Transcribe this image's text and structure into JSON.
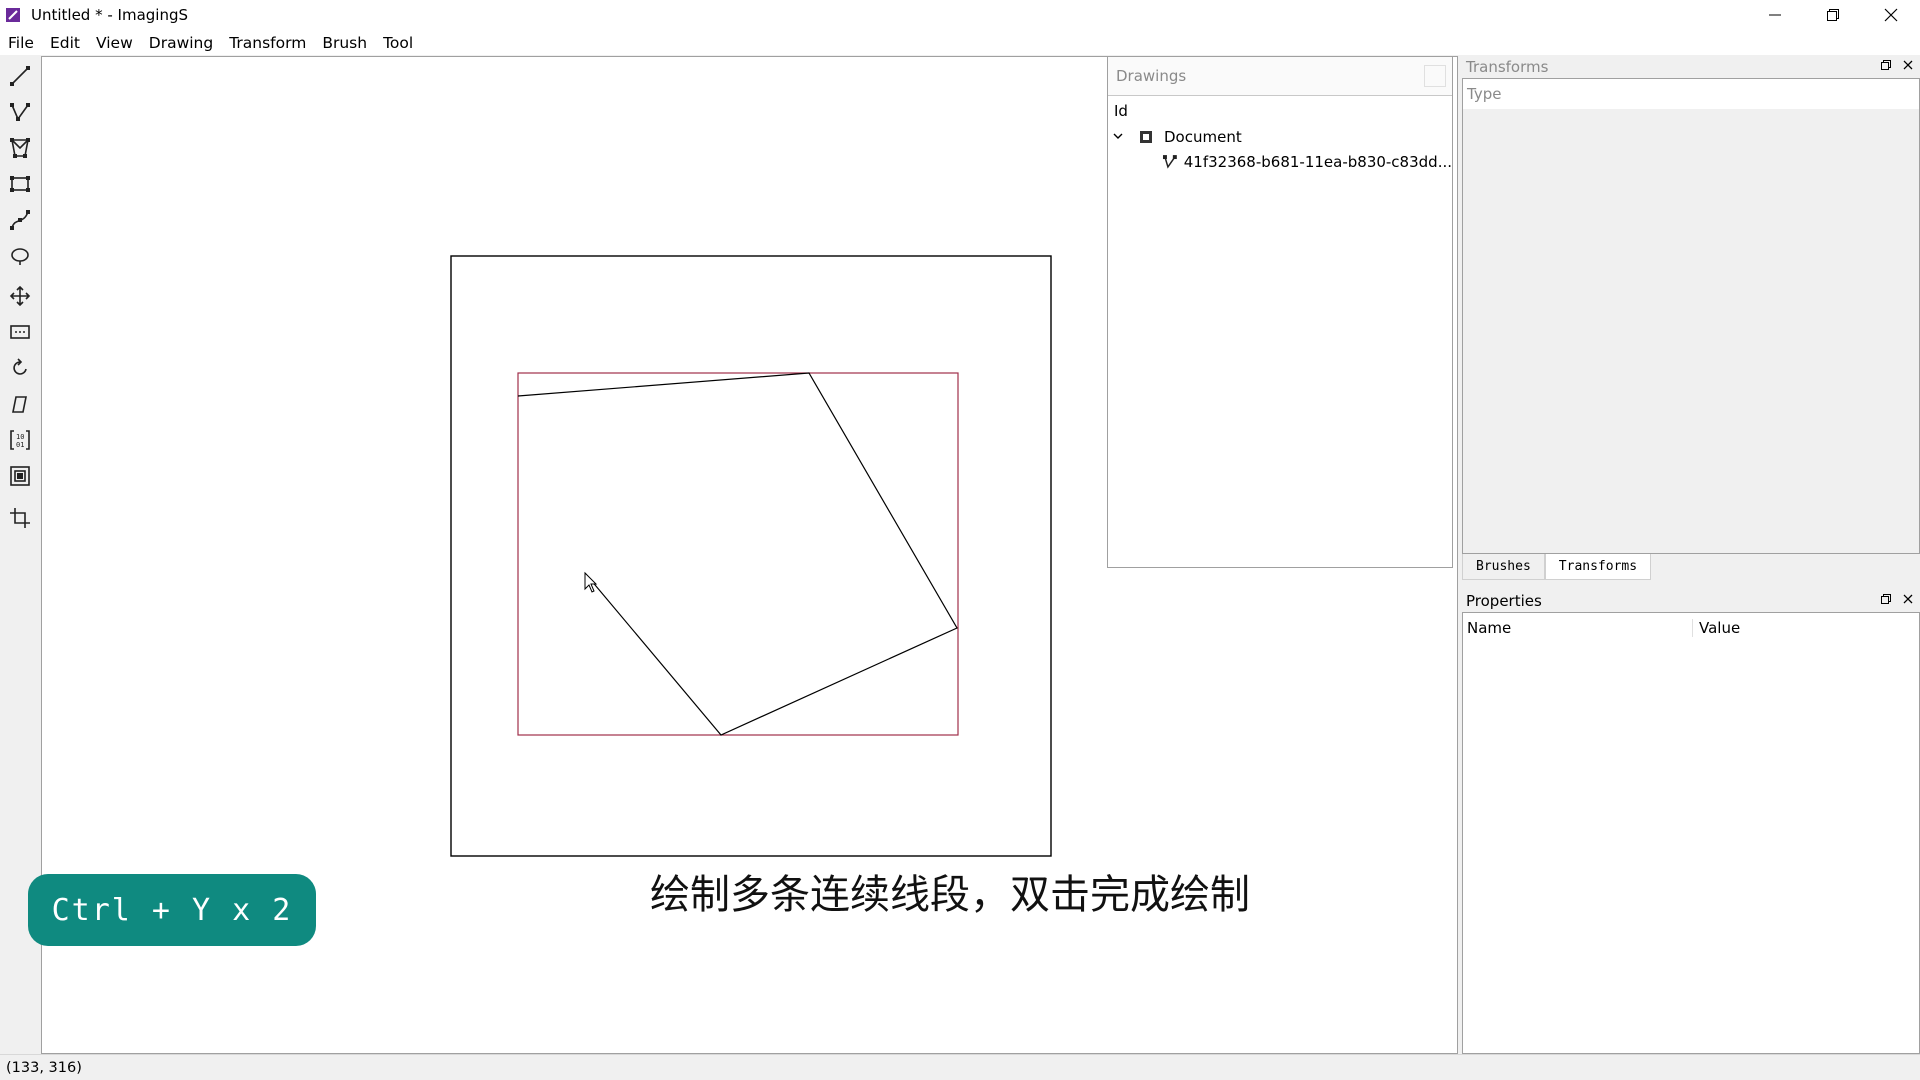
{
  "window": {
    "title": "Untitled * - ImagingS"
  },
  "menu": [
    "File",
    "Edit",
    "View",
    "Drawing",
    "Transform",
    "Brush",
    "Tool"
  ],
  "tools": [
    "line-tool-icon",
    "polyline-tool-icon",
    "polygon-tool-icon",
    "rectangle-tool-icon",
    "curve-tool-icon",
    "ellipse-tool-icon",
    "move-tool-icon",
    "select-tool-icon",
    "rotate-tool-icon",
    "skew-tool-icon",
    "scale-tool-icon",
    "clip-tool-icon",
    "crop-tool-icon"
  ],
  "drawings_panel": {
    "title": "Drawings",
    "column": "Id",
    "root": "Document",
    "child": "41f32368-b681-11ea-b830-c83dd..."
  },
  "transforms_panel": {
    "title": "Transforms",
    "column": "Type",
    "tabs": [
      "Brushes",
      "Transforms"
    ],
    "active_tab": "Transforms"
  },
  "properties_panel": {
    "title": "Properties",
    "columns": [
      "Name",
      "Value"
    ]
  },
  "overlay": {
    "shortcut": "Ctrl + Y x 2",
    "caption": "绘制多条连续线段，双击完成绘制"
  },
  "status": {
    "coords": "(133, 316)"
  },
  "colors": {
    "accent": "#0f8a80",
    "bounding_box": "#a0304a",
    "shape_stroke": "#000000"
  }
}
